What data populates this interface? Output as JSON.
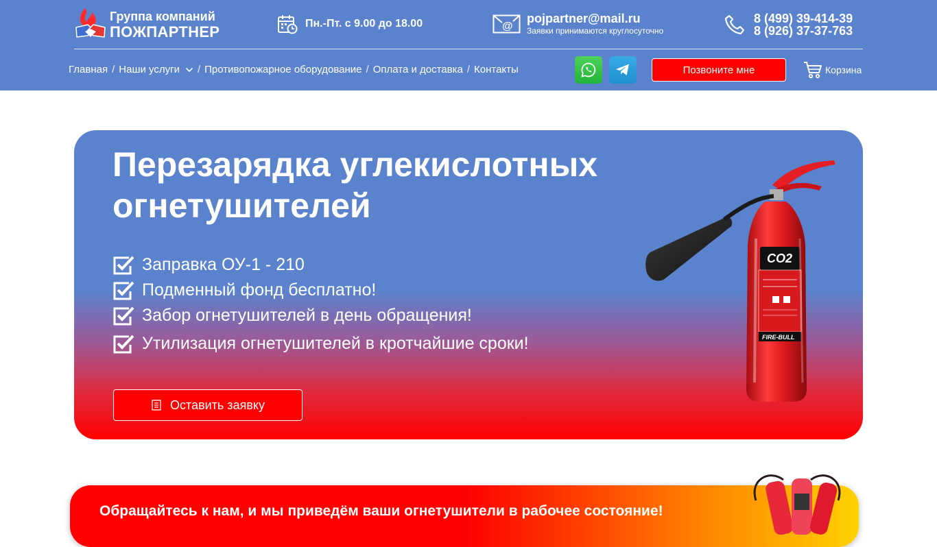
{
  "header": {
    "logo": {
      "line1": "Группа компаний",
      "line2": "ПОЖПАРТНЕР"
    },
    "hours": "Пн.-Пт. с 9.00 до 18.00",
    "email": {
      "address": "pojpartner@mail.ru",
      "note": "Заявки принимаются круглосуточно"
    },
    "phones": [
      "8 (499) 39-414-39",
      "8 (926) 37-37-763"
    ],
    "nav": [
      {
        "label": "Главная"
      },
      {
        "label": "Наши услуги",
        "has_dropdown": true
      },
      {
        "label": "Противопожарное оборудование"
      },
      {
        "label": "Оплата и доставка"
      },
      {
        "label": "Контакты"
      }
    ],
    "nav_separator": "/",
    "messengers": [
      "whatsapp-icon",
      "telegram-icon"
    ],
    "call_button": "Позвоните мне",
    "cart_label": "Корзина"
  },
  "hero": {
    "title": "Перезарядка углекислотных огнетушителей",
    "features": [
      "Заправка ОУ-1 - 210 ",
      "Подменный фонд бесплатно!",
      "Забор огнетушителей в день обращения!",
      "Утилизация огнетушителей в кротчайшие сроки!"
    ],
    "cta_label": "Оставить заявку",
    "image_label": "CO2",
    "image_brand": "FIRE-BULL"
  },
  "banner": {
    "text": "Обращайтесь к нам, и мы приведём ваши огнетушители в рабочее состояние!"
  },
  "colors": {
    "header_bg": "#5b82cc",
    "accent_red": "#ff0000",
    "banner_yellow": "#ffd200",
    "whatsapp": "#2cbf45",
    "telegram": "#2a9ddd"
  }
}
